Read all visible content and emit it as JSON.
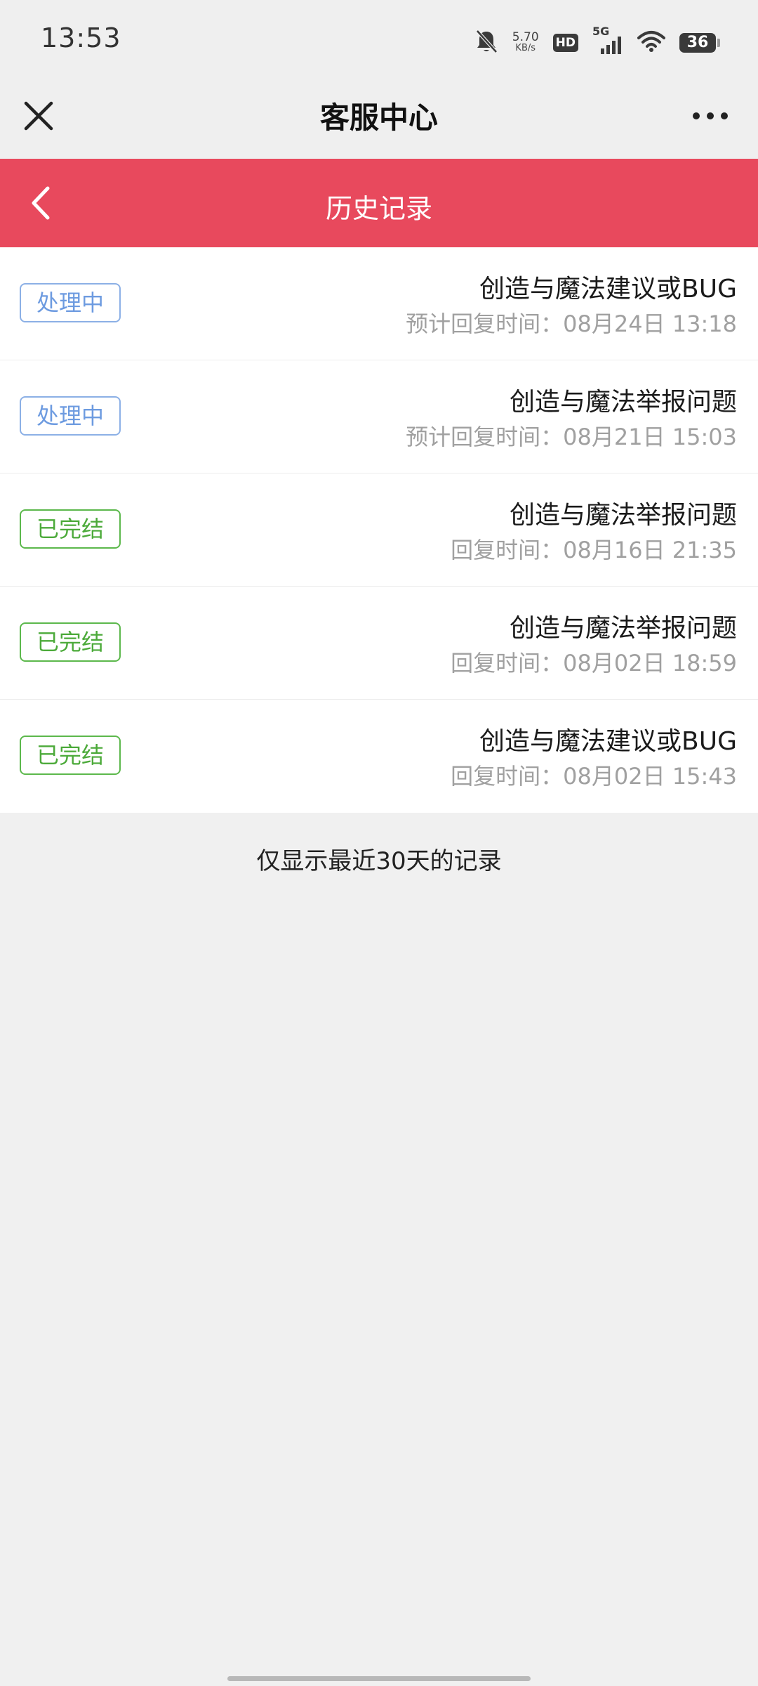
{
  "status_bar": {
    "time": "13:53",
    "net_speed_value": "5.70",
    "net_speed_unit": "KB/s",
    "hd_label": "HD",
    "network_label": "5G",
    "battery_level": "36"
  },
  "nav": {
    "title": "客服中心"
  },
  "header": {
    "title": "历史记录"
  },
  "records": [
    {
      "status": "处理中",
      "status_type": "processing",
      "title": "创造与魔法建议或BUG",
      "time": "预计回复时间：08月24日 13:18"
    },
    {
      "status": "处理中",
      "status_type": "processing",
      "title": "创造与魔法举报问题",
      "time": "预计回复时间：08月21日 15:03"
    },
    {
      "status": "已完结",
      "status_type": "done",
      "title": "创造与魔法举报问题",
      "time": "回复时间：08月16日 21:35"
    },
    {
      "status": "已完结",
      "status_type": "done",
      "title": "创造与魔法举报问题",
      "time": "回复时间：08月02日 18:59"
    },
    {
      "status": "已完结",
      "status_type": "done",
      "title": "创造与魔法建议或BUG",
      "time": "回复时间：08月02日 15:43"
    }
  ],
  "footer_note": "仅显示最近30天的记录",
  "colors": {
    "header_red": "#e8495d",
    "processing_blue": "#6d9be0",
    "done_green": "#4caa3a",
    "page_bg": "#f0f0f0"
  },
  "icons": {
    "close": "close-icon",
    "more": "more-icon",
    "back": "chevron-left-icon",
    "silent": "bell-off-icon",
    "signal": "signal-icon",
    "wifi": "wifi-icon",
    "battery": "battery-icon"
  }
}
